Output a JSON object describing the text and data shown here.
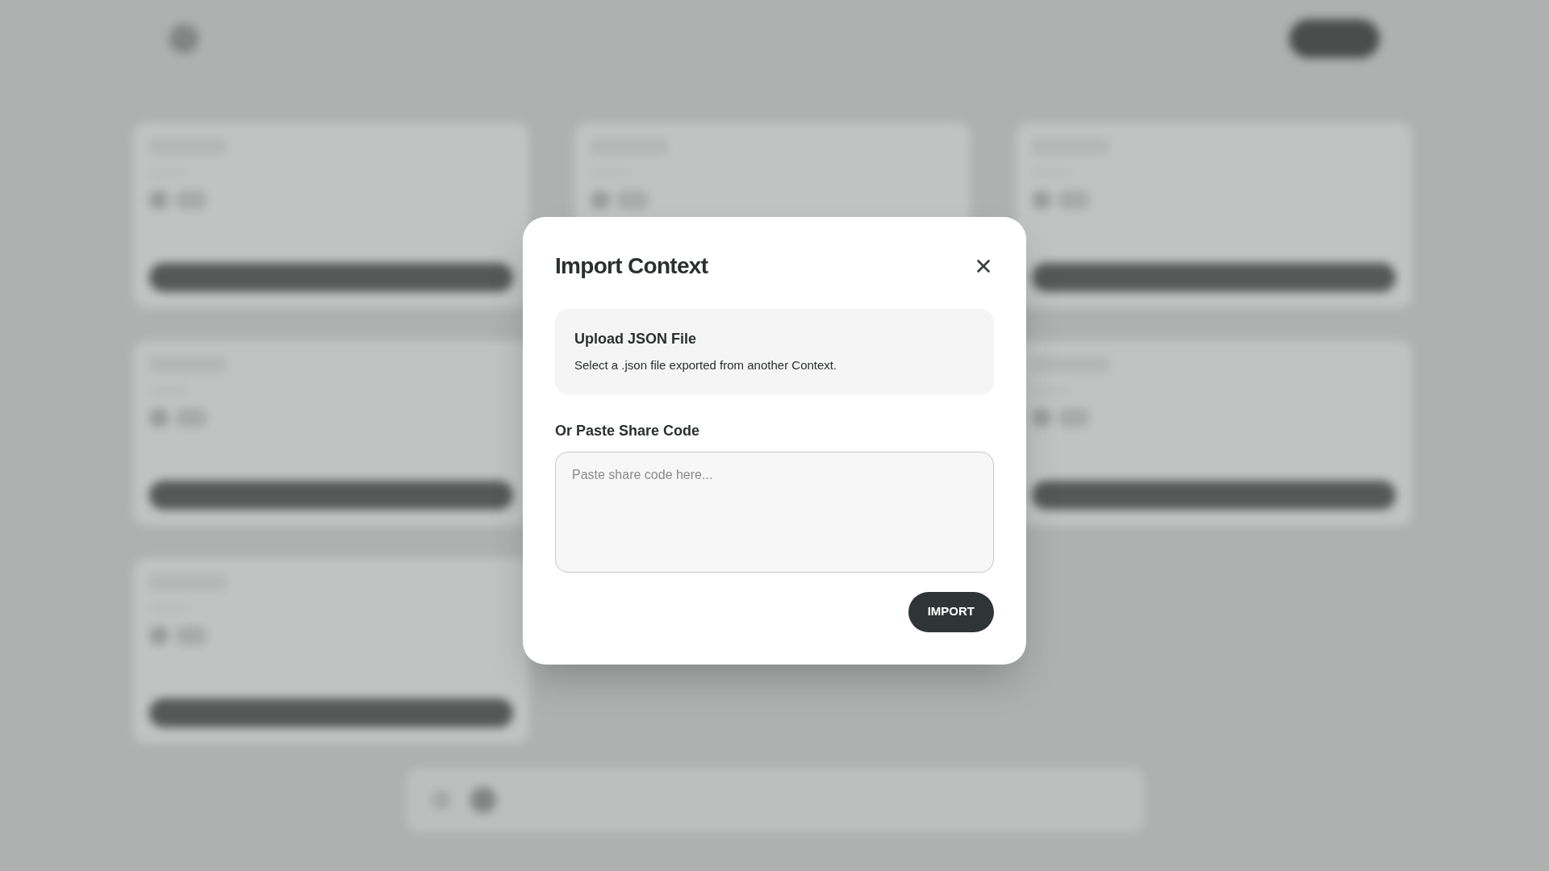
{
  "dialog": {
    "title": "Import Context",
    "upload": {
      "title": "Upload JSON File",
      "description": "Select a .json file exported from another Context."
    },
    "share_code": {
      "label": "Or Paste Share Code",
      "placeholder": "Paste share code here..."
    },
    "button": "IMPORT"
  }
}
